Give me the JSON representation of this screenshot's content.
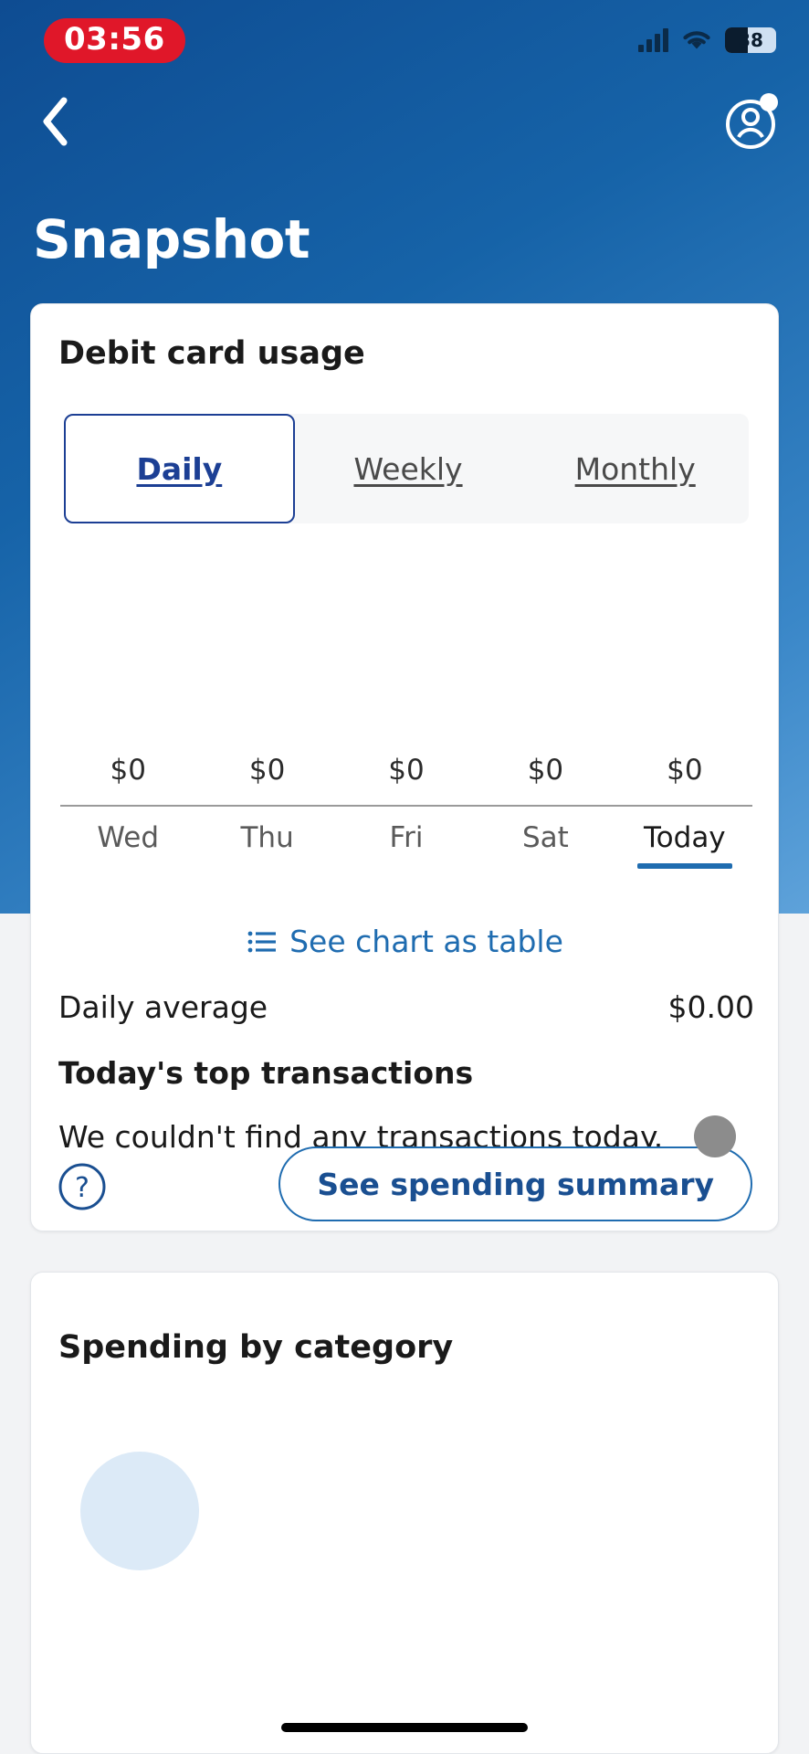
{
  "status_bar": {
    "time": "03:56",
    "battery_percent": "38",
    "signal_icon": "cellular-signal-icon",
    "wifi_icon": "wifi-icon",
    "battery_icon": "battery-icon"
  },
  "nav": {
    "back_icon": "chevron-left-icon",
    "profile_icon": "account-avatar-icon",
    "notification_dot": "notification-dot"
  },
  "header": {
    "title": "Snapshot"
  },
  "usage_card": {
    "title": "Debit card usage",
    "tabs": [
      {
        "label": "Daily",
        "active": true
      },
      {
        "label": "Weekly",
        "active": false
      },
      {
        "label": "Monthly",
        "active": false
      }
    ],
    "table_link": {
      "label": "See chart as table",
      "icon": "list-view-icon"
    },
    "daily_average": {
      "label": "Daily average",
      "value": "$0.00"
    },
    "transactions": {
      "heading": "Today's top transactions",
      "empty_message": "We couldn't find any transactions today."
    },
    "help_icon": "help-circle-icon",
    "summary_button": "See spending summary",
    "drag_handle": "drag-handle"
  },
  "category_card": {
    "title": "Spending by category"
  },
  "colors": {
    "brand_navy": "#1c3f94",
    "link_blue": "#1f6cb0",
    "header_blue": "#1663a8",
    "alert_red": "#e01729",
    "today_underline": "#1f6cb0"
  },
  "chart_data": {
    "type": "bar",
    "title": "Debit card usage",
    "categories": [
      "Wed",
      "Thu",
      "Fri",
      "Sat",
      "Today"
    ],
    "values": [
      0,
      0,
      0,
      0,
      0
    ],
    "value_labels": [
      "$0",
      "$0",
      "$0",
      "$0",
      "$0"
    ],
    "selected_category": "Today",
    "xlabel": "",
    "ylabel": "",
    "ylim": [
      0,
      0
    ],
    "grid": false,
    "legend": "none"
  }
}
